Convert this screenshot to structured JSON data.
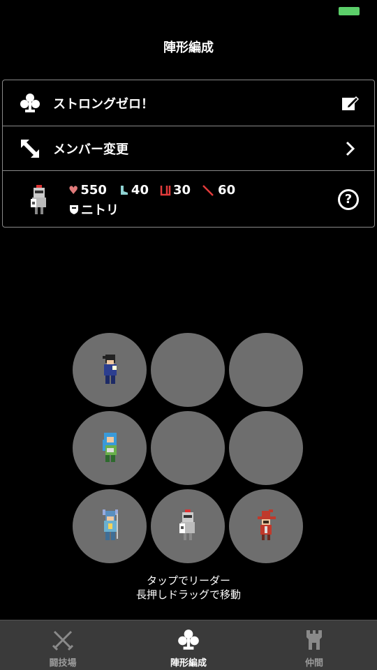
{
  "status_bar": {
    "battery_color": "#5ccf6a"
  },
  "header": {
    "title": "陣形編成"
  },
  "formation": {
    "name": "ストロングゼロ！",
    "icon": "clubs-icon",
    "edit_icon": "edit-icon"
  },
  "member_change": {
    "label": "メンバー変更",
    "icon": "swap-arrows-icon"
  },
  "leader": {
    "hp": "550",
    "speed": "40",
    "defense": "30",
    "attack": "60",
    "skill": "ニトリ",
    "help": "?"
  },
  "grid": {
    "slots": [
      "ninja",
      "empty",
      "empty",
      "blue-haired-mage",
      "empty",
      "empty",
      "dragoon",
      "armored-knight",
      "red-mage"
    ]
  },
  "hint": {
    "line1": "タップでリーダー",
    "line2": "長押しドラッグで移動"
  },
  "tabs": [
    {
      "label": "闘技場",
      "icon": "crossed-swords-icon",
      "active": false
    },
    {
      "label": "陣形編成",
      "icon": "clubs-icon",
      "active": true
    },
    {
      "label": "仲間",
      "icon": "castle-tower-icon",
      "active": false
    }
  ],
  "colors": {
    "heart": "#e07a7a",
    "boot": "#8fd3d3",
    "shield": "#e23b3b",
    "sword": "#e23b3b"
  }
}
